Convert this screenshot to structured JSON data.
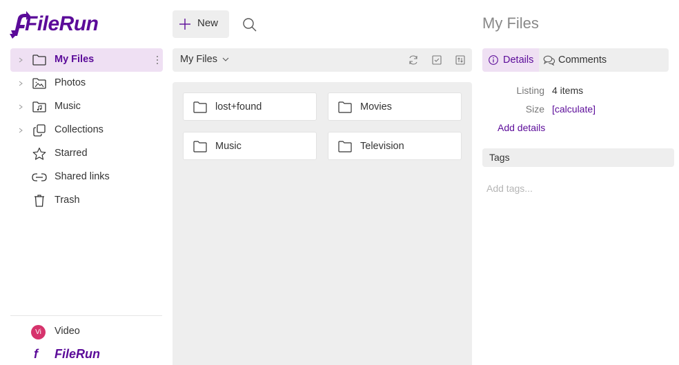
{
  "app": {
    "brand": "FileRun",
    "accent_color": "#5b0b99",
    "active_bg_color": "#efe0f3"
  },
  "sidebar": {
    "items": [
      {
        "label": "My Files",
        "icon": "folder-icon",
        "expandable": true,
        "active": true
      },
      {
        "label": "Photos",
        "icon": "photo-folder-icon",
        "expandable": true,
        "active": false
      },
      {
        "label": "Music",
        "icon": "music-folder-icon",
        "expandable": true,
        "active": false
      },
      {
        "label": "Collections",
        "icon": "collections-icon",
        "expandable": true,
        "active": false
      },
      {
        "label": "Starred",
        "icon": "star-icon",
        "expandable": false,
        "active": false
      },
      {
        "label": "Shared links",
        "icon": "link-icon",
        "expandable": false,
        "active": false
      },
      {
        "label": "Trash",
        "icon": "trash-icon",
        "expandable": false,
        "active": false
      }
    ],
    "user": {
      "initials": "Vi",
      "name": "Video",
      "avatar_color": "#d6336c"
    },
    "footer_brand": "FileRun",
    "footer_mark": "f"
  },
  "toolbar": {
    "new_label": "New",
    "search_icon": "search-icon"
  },
  "breadcrumb": {
    "current": "My Files",
    "actions": [
      "refresh-icon",
      "select-icon",
      "sort-icon"
    ]
  },
  "files": [
    {
      "name": "lost+found",
      "type": "folder"
    },
    {
      "name": "Movies",
      "type": "folder"
    },
    {
      "name": "Music",
      "type": "folder"
    },
    {
      "name": "Television",
      "type": "folder"
    }
  ],
  "details": {
    "title": "My Files",
    "tabs": [
      {
        "label": "Details",
        "icon": "info-icon",
        "active": true
      },
      {
        "label": "Comments",
        "icon": "comments-icon",
        "active": false
      }
    ],
    "listing_label": "Listing",
    "listing_value": "4 items",
    "size_label": "Size",
    "size_value": "[calculate]",
    "add_details": "Add details",
    "tags_label": "Tags",
    "tags_placeholder": "Add tags..."
  }
}
